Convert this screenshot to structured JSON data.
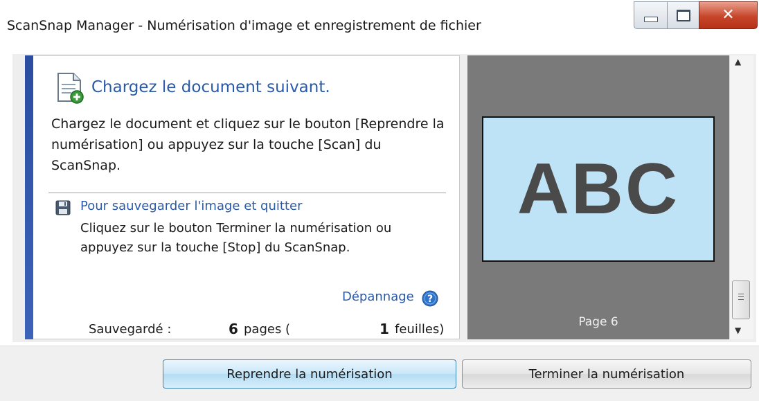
{
  "window": {
    "title": "ScanSnap Manager - Numérisation d'image et enregistrement de fichier"
  },
  "left_panel": {
    "heading": "Chargez le document suivant.",
    "instruction": "Chargez le document et cliquez sur le bouton [Reprendre la numérisation] ou appuyez sur la touche [Scan] du ScanSnap.",
    "save_section": {
      "title": "Pour sauvegarder l'image et quitter",
      "detail": "Cliquez sur le bouton Terminer la numérisation ou appuyez sur la touche [Stop] du ScanSnap."
    },
    "troubleshoot_label": "Dépannage",
    "status": {
      "label": "Sauvegardé :",
      "pages_count": "6",
      "pages_text": "pages (",
      "sheets_count": "1",
      "sheets_text": "feuilles)"
    }
  },
  "preview": {
    "thumbnail_text": "ABC",
    "page_caption": "Page 6"
  },
  "buttons": {
    "resume": "Reprendre la numérisation",
    "finish": "Terminer la numérisation"
  },
  "icons": {
    "document": "document-add-icon",
    "save": "floppy-disk-icon",
    "help": "help-icon"
  },
  "colors": {
    "accent": "#2a5aa8",
    "preview_background": "#7a7a7a",
    "thumbnail_background": "#bfe3f6",
    "close_button": "#c7462a"
  }
}
